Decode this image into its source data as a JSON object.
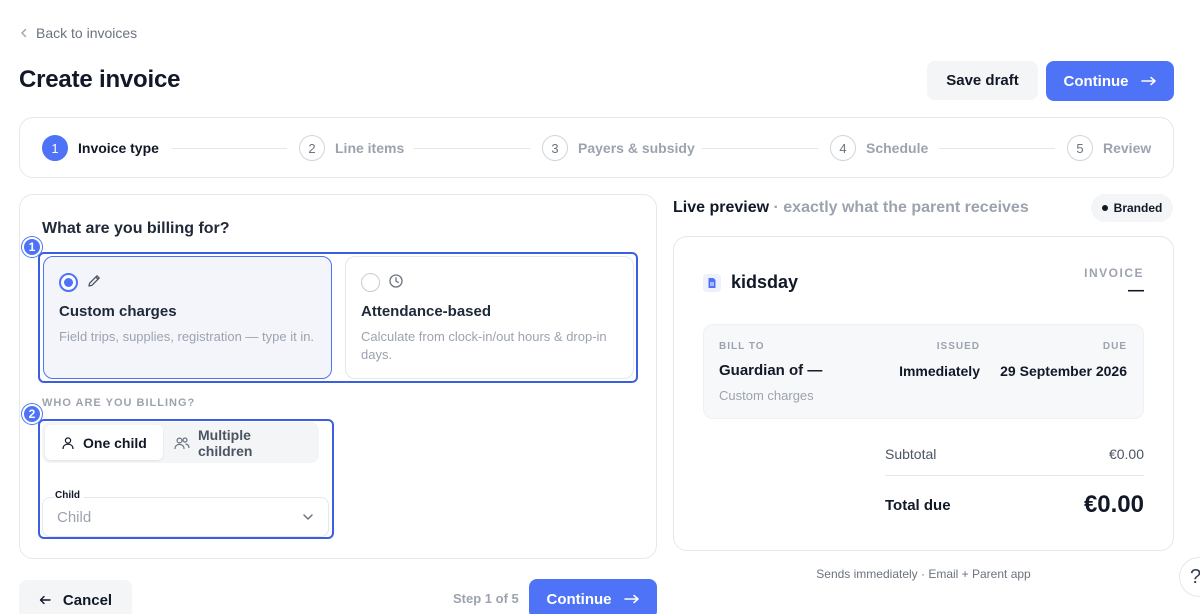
{
  "nav": {
    "back_label": "Back to invoices"
  },
  "header": {
    "title": "Create invoice",
    "save_draft_label": "Save draft",
    "continue_label": "Continue"
  },
  "stepper": {
    "steps": [
      {
        "num": "1",
        "label": "Invoice type"
      },
      {
        "num": "2",
        "label": "Line items"
      },
      {
        "num": "3",
        "label": "Payers & subsidy"
      },
      {
        "num": "4",
        "label": "Schedule"
      },
      {
        "num": "5",
        "label": "Review"
      }
    ]
  },
  "form": {
    "question": "What are you billing for?",
    "markers": [
      "1",
      "2"
    ],
    "options": [
      {
        "name": "Custom charges",
        "desc": "Field trips, supplies, registration — type it in.",
        "icon": "pencil-icon",
        "selected": true
      },
      {
        "name": "Attendance-based",
        "desc": "Calculate from clock-in/out hours & drop-in days.",
        "icon": "clock-icon",
        "selected": false
      }
    ],
    "who_label": "WHO ARE YOU BILLING?",
    "segments": [
      {
        "label": "One child",
        "icon": "user-icon",
        "active": true
      },
      {
        "label": "Multiple children",
        "icon": "users-icon",
        "active": false
      }
    ],
    "child_label": "Child",
    "child_placeholder": "Child"
  },
  "footer": {
    "cancel_label": "Cancel",
    "step_count": "Step 1 of 5",
    "continue_label": "Continue"
  },
  "preview": {
    "title": "Live preview",
    "subtitle": "· exactly what the parent receives",
    "badge": "Branded",
    "brand_name": "kidsday",
    "invoice_label": "INVOICE",
    "invoice_number": "—",
    "bill_to_label": "BILL TO",
    "bill_to_name": "Guardian of —",
    "bill_to_sub": "Custom charges",
    "issued_label": "ISSUED",
    "issued_value": "Immediately",
    "due_label": "DUE",
    "due_value": "29 September 2026",
    "subtotal_label": "Subtotal",
    "subtotal_value": "€0.00",
    "total_label": "Total due",
    "total_value": "€0.00",
    "sends_note": "Sends immediately · Email + Parent app"
  },
  "help": {
    "label": "?"
  },
  "colors": {
    "accent": "#4f73f6",
    "highlight": "#3b5fe0",
    "muted": "#9ca3af"
  }
}
